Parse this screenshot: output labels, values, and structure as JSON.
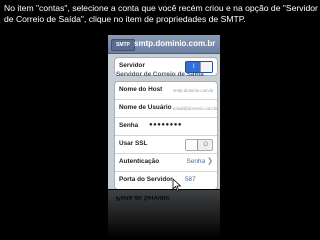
{
  "caption": "No item \"contas\", selecione a conta que você recém criou e na opção de \"Servidor de Correio de Saída\", clique no item de propriedades de SMTP.",
  "navbar": {
    "back_label": "SMTP",
    "title": "smtp.dominio.com.br"
  },
  "server": {
    "label": "Servidor",
    "toggle_text": "I"
  },
  "section_title": "Servidor de Correio de Saída",
  "fields": {
    "host": {
      "label": "Nome do Host",
      "placeholder": "smtp.dominio.com.br"
    },
    "user": {
      "label": "Nome de Usuário",
      "placeholder": "email@dominio.com.br"
    },
    "password": {
      "label": "Senha",
      "value": "●●●●●●●●"
    }
  },
  "ssl": {
    "label": "Usar SSL",
    "toggle_text": "O"
  },
  "auth": {
    "label": "Autenticação",
    "value": "Senha"
  },
  "port": {
    "label": "Porta do Servidor",
    "value": "587"
  },
  "reflection_text": "Porta do Servidor"
}
